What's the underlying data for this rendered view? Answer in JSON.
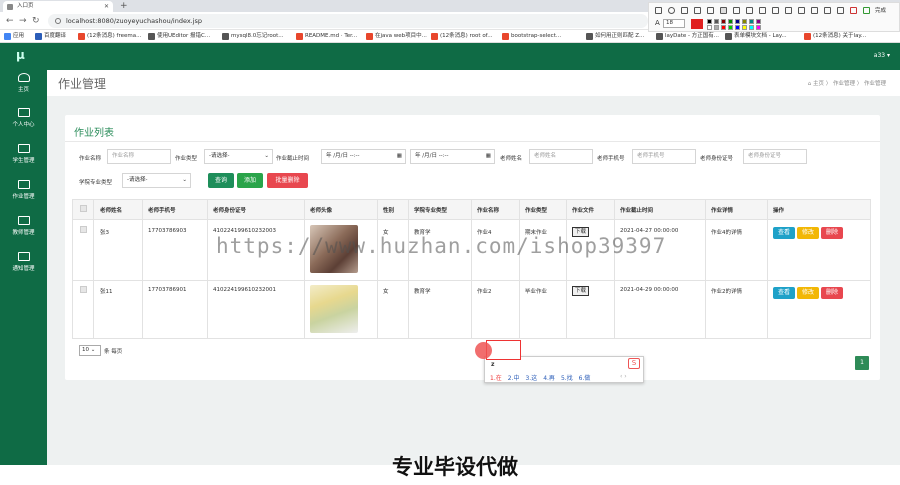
{
  "browser": {
    "tab_title": "入口页",
    "url": "localhost:8080/zuoyeyuchashou/index.jsp",
    "bookmarks": [
      {
        "label": "应用",
        "color": "#4285f4"
      },
      {
        "label": "百度翻译",
        "color": "#2b5db8"
      },
      {
        "label": "(12条消息) freema...",
        "color": "#e8462c"
      },
      {
        "label": "使用UEditor 报错C...",
        "color": "#555555"
      },
      {
        "label": "mysql8.0忘记root...",
        "color": "#555555"
      },
      {
        "label": "README.md · Ter...",
        "color": "#e8462c"
      },
      {
        "label": "在java web项目中...",
        "color": "#e8462c"
      },
      {
        "label": "(12条消息) root of...",
        "color": "#e8462c"
      },
      {
        "label": "bootstrap-select...",
        "color": "#e8462c"
      },
      {
        "label": "如何用正则匹配 Z...",
        "color": "#555555"
      },
      {
        "label": "layDate - 方正国有...",
        "color": "#555555"
      },
      {
        "label": "表单模块文档 - Lay...",
        "color": "#555555"
      },
      {
        "label": "(12条消息) 关于lay...",
        "color": "#e8462c"
      }
    ],
    "annot_font_size": "18",
    "annot_done": "完成"
  },
  "app": {
    "logo": "μ",
    "user": "a33 ▾",
    "sidebar": [
      {
        "label": "主页",
        "icon": "dashboard-icon"
      },
      {
        "label": "个人中心",
        "icon": "monitor-icon"
      },
      {
        "label": "学生管理",
        "icon": "monitor-icon"
      },
      {
        "label": "作业管理",
        "icon": "monitor-icon"
      },
      {
        "label": "教师管理",
        "icon": "monitor-icon"
      },
      {
        "label": "通知管理",
        "icon": "monitor-icon"
      }
    ],
    "page_title": "作业管理",
    "breadcrumb": [
      "主页",
      "作业管理",
      "作业管理"
    ],
    "card_title": "作业列表",
    "filters": {
      "homework_name_label": "作业名称",
      "homework_name_placeholder": "作业名称",
      "homework_type_label": "作业类型",
      "homework_type_value": "-请选择-",
      "deadline_label": "作业截止时间",
      "date_placeholder": "年 /月/日 --:--",
      "teacher_name_label": "老师姓名",
      "teacher_name_placeholder": "老师姓名",
      "teacher_phone_label": "老师手机号",
      "teacher_phone_placeholder": "老师手机号",
      "teacher_id_label": "老师身份证号",
      "teacher_id_placeholder": "老师身份证号",
      "major_label": "学院专业类型",
      "major_value": "-请选择-"
    },
    "buttons": {
      "search": "查询",
      "add": "添加",
      "batch_delete": "批量删除"
    },
    "table": {
      "headers": [
        "老师姓名",
        "老师手机号",
        "老师身份证号",
        "老师头像",
        "性别",
        "学院专业类型",
        "作业名称",
        "作业类型",
        "作业文件",
        "作业截止时间",
        "作业详情",
        "操作"
      ],
      "rows": [
        {
          "name": "张3",
          "phone": "17703786903",
          "idcard": "410224199610232003",
          "gender": "女",
          "major": "教育学",
          "hw_name": "作业4",
          "hw_type": "期末作业",
          "file": "下载",
          "deadline": "2021-04-27 00:00:00",
          "detail": "作业4的详情"
        },
        {
          "name": "张11",
          "phone": "17703786901",
          "idcard": "410224199610232001",
          "gender": "女",
          "major": "教育学",
          "hw_name": "作业2",
          "hw_type": "毕业作业",
          "file": "下载",
          "deadline": "2021-04-29 00:00:00",
          "detail": "作业2的详情"
        }
      ],
      "actions": {
        "view": "查看",
        "edit": "修改",
        "delete": "删除"
      }
    },
    "page_size": "10",
    "page_size_suffix": "条 每页",
    "current_page": "1"
  },
  "ime": {
    "input": "z",
    "candidates": [
      "1.在",
      "2.中",
      "3.这",
      "4.再",
      "5.找",
      "6.做"
    ],
    "nav": "‹ ›",
    "logo": "S"
  },
  "overlay": {
    "watermark": "https://www.huzhan.com/ishop39397",
    "caption": "专业毕设代做"
  },
  "colors": {
    "primary_green": "#0f6b45",
    "btn_search": "#1e8e5a",
    "btn_add": "#2aa44a",
    "btn_delete": "#e8474f",
    "btn_view": "#1ea1c8",
    "btn_edit": "#f2b705"
  }
}
